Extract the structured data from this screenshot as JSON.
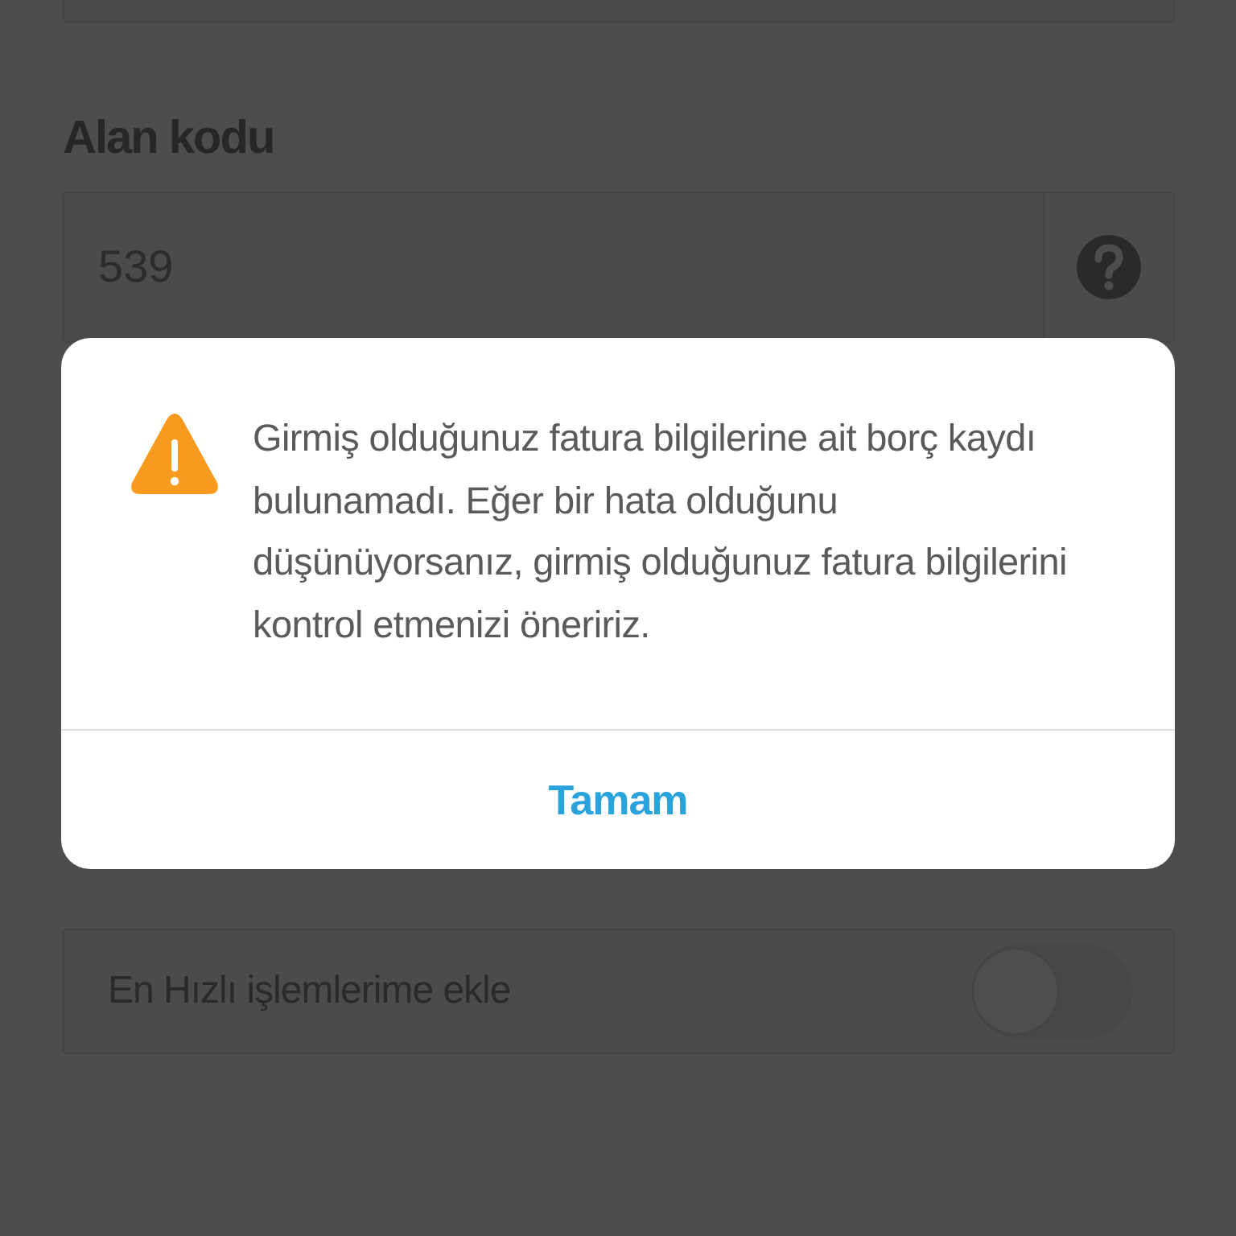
{
  "form": {
    "area_code": {
      "label": "Alan kodu",
      "value": "539"
    },
    "quick_toggle": {
      "label": "En Hızlı işlemlerime ekle",
      "on": false
    }
  },
  "dialog": {
    "message": "Girmiş olduğunuz fatura bilgilerine ait borç kaydı bulunamadı. Eğer bir hata olduğunu düşünüyorsanız, girmiş olduğunuz fatura bilgilerini kontrol etmenizi öneririz.",
    "button": "Tamam"
  }
}
